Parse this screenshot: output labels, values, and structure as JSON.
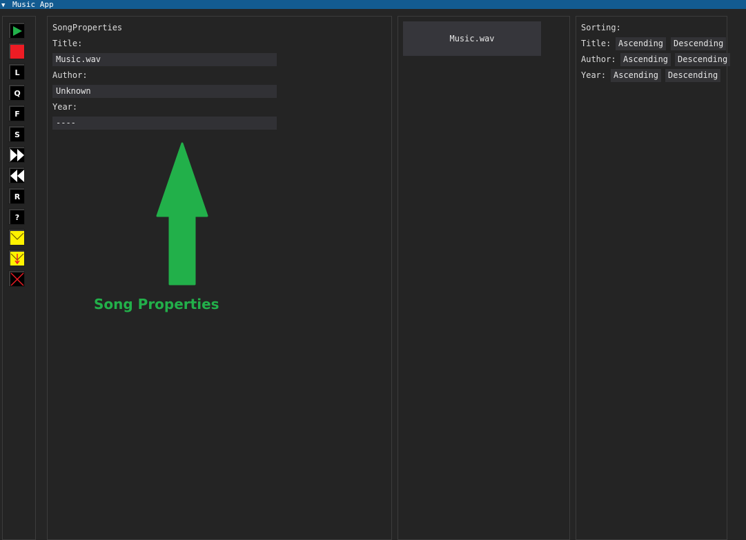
{
  "window": {
    "title": "Music App",
    "collapse_glyph": "▼"
  },
  "toolbar": {
    "buttons": [
      {
        "name": "play-button",
        "icon": "play-icon",
        "glyph": "",
        "color": "#22b04a"
      },
      {
        "name": "stop-button",
        "icon": "stop-icon",
        "glyph": "",
        "color": "#ed1c24"
      },
      {
        "name": "load-button",
        "icon": "letter-l-icon",
        "glyph": "L"
      },
      {
        "name": "queue-button",
        "icon": "letter-q-icon",
        "glyph": "Q"
      },
      {
        "name": "file-button",
        "icon": "letter-f-icon",
        "glyph": "F"
      },
      {
        "name": "save-button",
        "icon": "letter-s-icon",
        "glyph": "S"
      },
      {
        "name": "fast-forward-button",
        "icon": "fast-forward-icon",
        "glyph": ""
      },
      {
        "name": "rewind-button",
        "icon": "rewind-icon",
        "glyph": ""
      },
      {
        "name": "repeat-button",
        "icon": "letter-r-icon",
        "glyph": "R"
      },
      {
        "name": "help-button",
        "icon": "question-icon",
        "glyph": "?"
      },
      {
        "name": "mail-button",
        "icon": "envelope-icon",
        "glyph": "",
        "color": "#fff200"
      },
      {
        "name": "mail-download-button",
        "icon": "envelope-arrow-icon",
        "glyph": "",
        "color": "#fff200"
      },
      {
        "name": "close-button",
        "icon": "close-x-icon",
        "glyph": "",
        "color": "#ed1c24"
      }
    ]
  },
  "properties": {
    "heading": "SongProperties",
    "title_label": "Title:",
    "title_value": "Music.wav",
    "author_label": "Author:",
    "author_value": "Unknown",
    "year_label": "Year:",
    "year_value": "----",
    "annotation": "Song Properties",
    "annotation_color": "#22b04a"
  },
  "song_list": {
    "items": [
      "Music.wav"
    ]
  },
  "sorting": {
    "heading": "Sorting:",
    "rows": [
      {
        "label": "Title:",
        "asc": "Ascending",
        "desc": "Descending"
      },
      {
        "label": "Author:",
        "asc": "Ascending",
        "desc": "Descending"
      },
      {
        "label": "Year:",
        "asc": "Ascending",
        "desc": "Descending"
      }
    ]
  }
}
